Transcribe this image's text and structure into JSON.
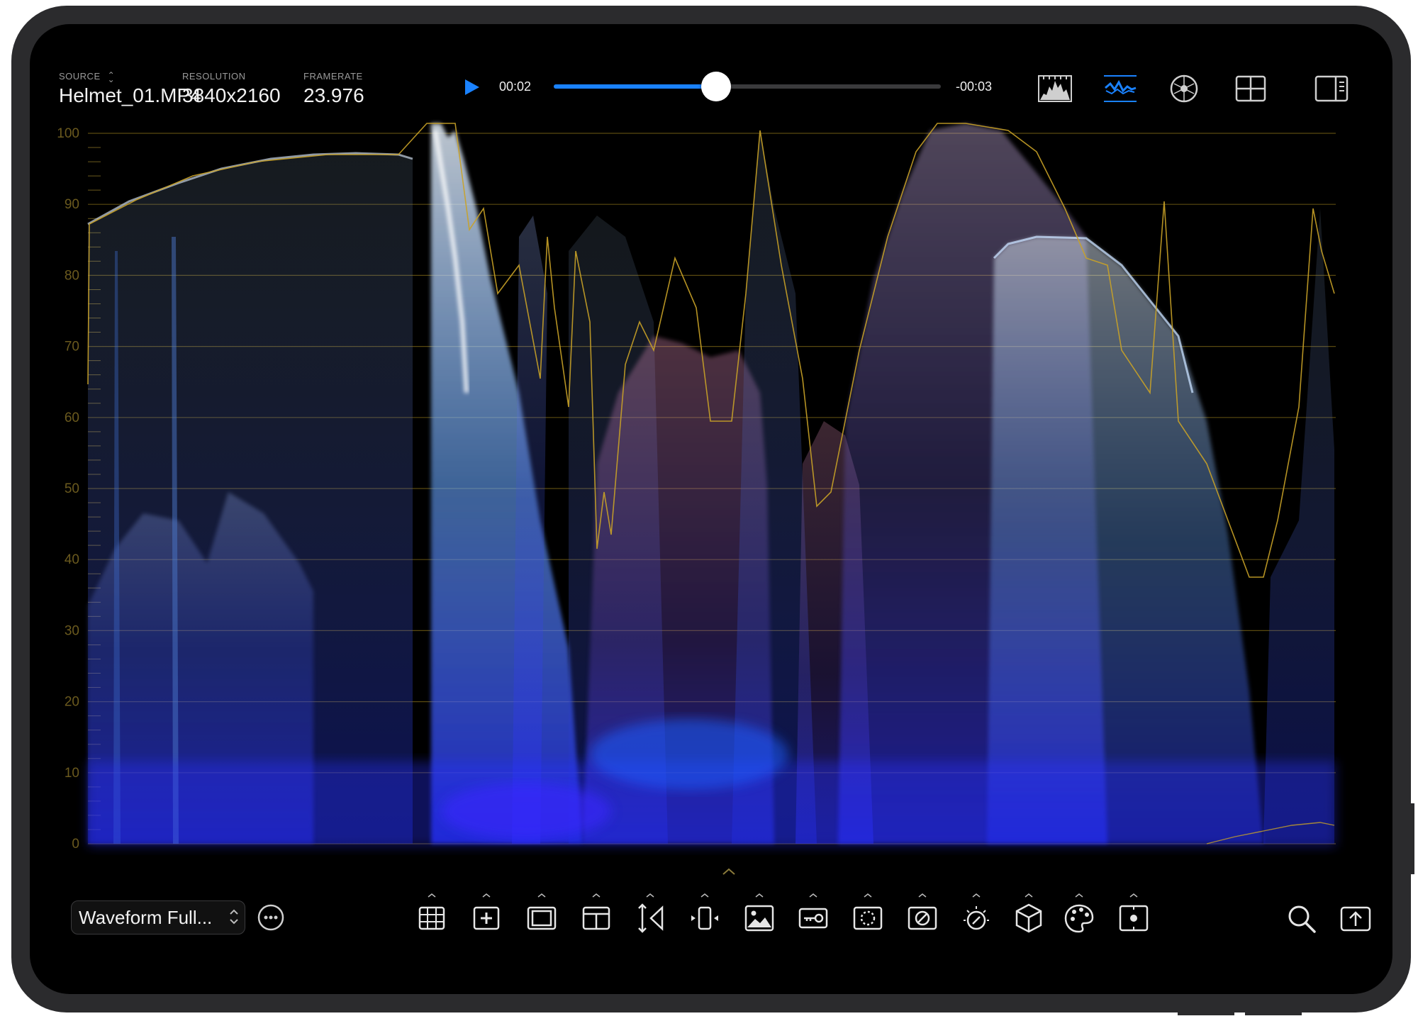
{
  "source": {
    "label": "SOURCE",
    "value": "Helmet_01.MP4"
  },
  "resolution": {
    "label": "RESOLUTION",
    "value": "3840x2160"
  },
  "framerate": {
    "label": "FRAMERATE",
    "value": "23.976"
  },
  "playback": {
    "current_time": "00:02",
    "remaining_time": "-00:03",
    "progress": 0.42
  },
  "scope": {
    "type": "waveform",
    "y_ticks": [
      "100",
      "90",
      "80",
      "70",
      "60",
      "50",
      "40",
      "30",
      "20",
      "10",
      "0"
    ],
    "ylim": [
      0,
      100
    ],
    "grid_color": "#5a4a10",
    "tick_color": "#6b5a1e"
  },
  "bottom": {
    "preset_label": "Waveform Full..."
  },
  "colors": {
    "accent": "#1a82ff",
    "trace_yellow": "#c9a227"
  },
  "top_icons": [
    "histogram-icon",
    "waveform-icon",
    "vectorscope-icon",
    "quad-layout-icon",
    "sidebar-icon"
  ],
  "tools": [
    "grid-icon",
    "crosshair-icon",
    "safe-area-icon",
    "layout-icon",
    "flip-vertical-icon",
    "flip-horizontal-icon",
    "image-icon",
    "key-icon",
    "region-icon",
    "false-color-icon",
    "exposure-dial-icon",
    "3d-cube-icon",
    "palette-icon",
    "focus-icon"
  ]
}
